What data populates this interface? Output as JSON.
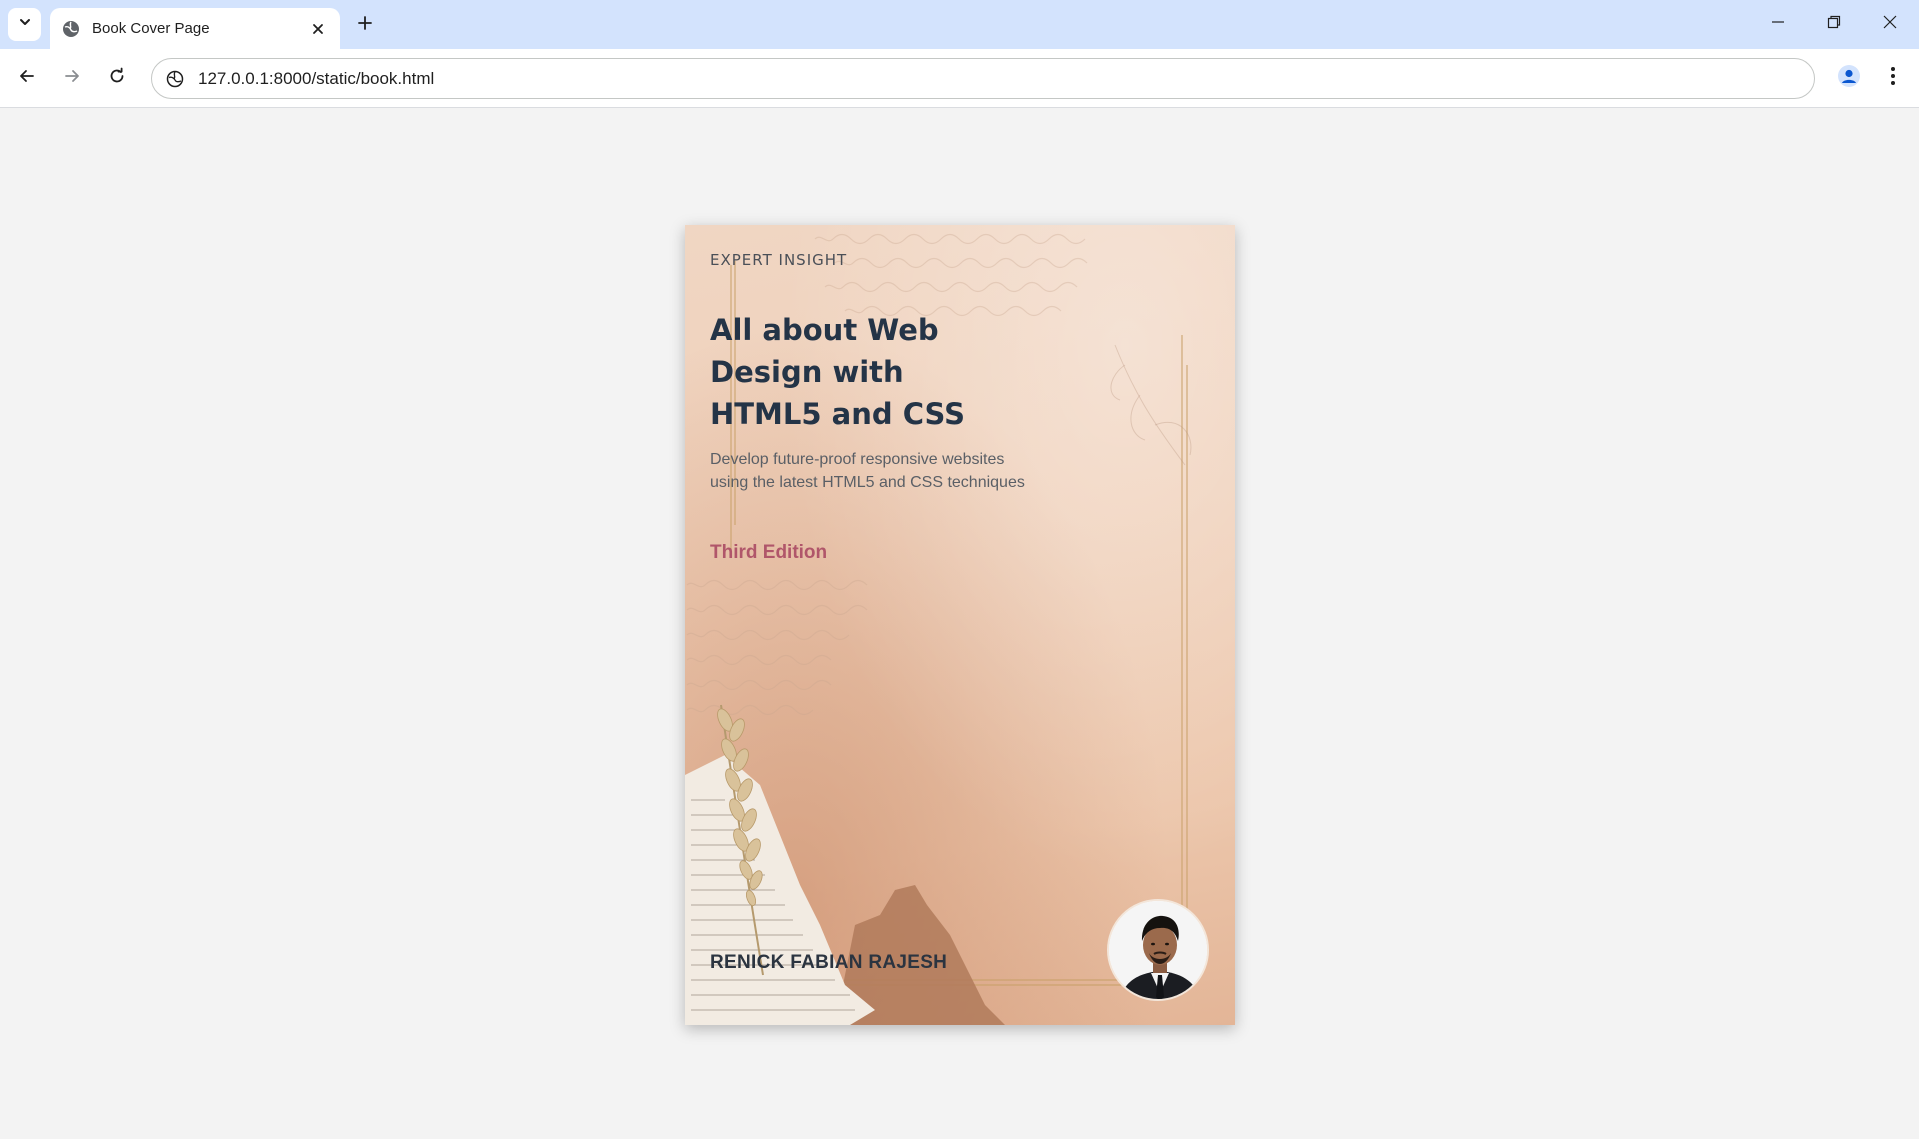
{
  "browser": {
    "tab": {
      "title": "Book Cover Page"
    },
    "omnibox": {
      "url": "127.0.0.1:8000/static/book.html"
    }
  },
  "cover": {
    "eyebrow": "EXPERT INSIGHT",
    "title_lines": [
      "All about Web",
      "Design with",
      "HTML5 and CSS"
    ],
    "subtitle_lines": [
      "Develop future-proof responsive websites",
      "using the latest HTML5 and CSS techniques"
    ],
    "edition": "Third Edition",
    "author": "RENICK FABIAN RAJESH"
  },
  "colors": {
    "chrome_tabstrip": "#d3e3fd",
    "title": "#243447",
    "edition": "#b0566a",
    "page_bg": "#f3f3f3"
  },
  "icons": {
    "tab_search": "chevron-down-icon",
    "favicon": "globe-icon",
    "tab_close": "close-icon",
    "new_tab": "plus-icon",
    "back": "arrow-left-icon",
    "forward": "arrow-right-icon",
    "reload": "reload-icon",
    "site_info": "site-info-icon",
    "profile": "profile-icon",
    "menu": "kebab-menu-icon"
  }
}
